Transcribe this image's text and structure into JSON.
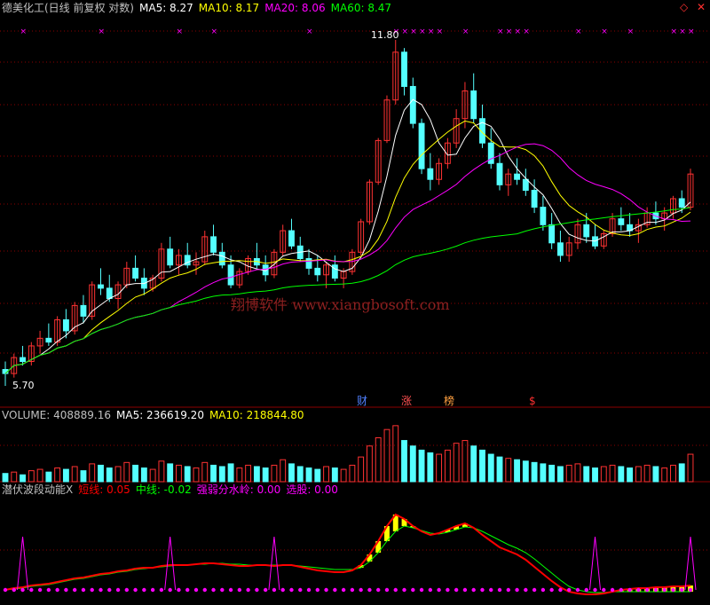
{
  "colors": {
    "bg": "#000000",
    "up": "#ff3232",
    "down": "#54ffff",
    "grid": "#8b0000",
    "ma5": "#ffffff",
    "ma10": "#ffff00",
    "ma20": "#ff00ff",
    "ma60": "#00ff00",
    "short": "#ff0000",
    "mid": "#00ff00",
    "strong": "#ffff00",
    "watershed": "#ff00ff",
    "pick": "#ff00ff"
  },
  "main": {
    "title": "德美化工(日线 前复权 对数)",
    "ma5": "MA5: 8.27",
    "ma10": "MA10: 8.17",
    "ma20": "MA20: 8.06",
    "ma60": "MA60: 8.47",
    "high_label": "11.80",
    "low_label": "5.70",
    "watermark": "翔博软件 www.xiangbosoft.com",
    "markers": [
      "财",
      "涨",
      "榜",
      "$"
    ]
  },
  "volume": {
    "label": "VOLUME: 408889.16",
    "ma5": "MA5: 236619.20",
    "ma10": "MA10: 218844.80"
  },
  "indicator": {
    "name": "潜伏波段动能X",
    "short": "短线: 0.05",
    "mid": "中线: -0.02",
    "watershed": "强弱分水岭: 0.00",
    "pick": "选股: 0.00"
  },
  "window_icons": [
    "diamond-icon",
    "close-icon"
  ],
  "chart_data": {
    "type": "candlestick",
    "title": "德美化工(日线 前复权 对数)",
    "price_range": [
      5.7,
      11.8
    ],
    "candles": [
      [
        5.9,
        6.0,
        5.7,
        5.85
      ],
      [
        5.85,
        6.1,
        5.8,
        6.05
      ],
      [
        6.05,
        6.2,
        5.95,
        6.0
      ],
      [
        6.0,
        6.25,
        5.95,
        6.2
      ],
      [
        6.2,
        6.4,
        6.1,
        6.3
      ],
      [
        6.3,
        6.5,
        6.2,
        6.25
      ],
      [
        6.25,
        6.6,
        6.2,
        6.55
      ],
      [
        6.55,
        6.7,
        6.3,
        6.4
      ],
      [
        6.4,
        6.8,
        6.35,
        6.75
      ],
      [
        6.75,
        6.9,
        6.5,
        6.6
      ],
      [
        6.6,
        7.1,
        6.55,
        7.05
      ],
      [
        7.05,
        7.3,
        6.9,
        7.0
      ],
      [
        7.0,
        7.2,
        6.8,
        6.85
      ],
      [
        6.85,
        7.1,
        6.7,
        7.05
      ],
      [
        7.05,
        7.4,
        7.0,
        7.3
      ],
      [
        7.3,
        7.5,
        7.1,
        7.15
      ],
      [
        7.15,
        7.3,
        6.9,
        7.0
      ],
      [
        7.0,
        7.2,
        6.95,
        7.15
      ],
      [
        7.15,
        7.7,
        7.1,
        7.6
      ],
      [
        7.6,
        7.8,
        7.3,
        7.35
      ],
      [
        7.35,
        7.6,
        7.2,
        7.5
      ],
      [
        7.5,
        7.7,
        7.3,
        7.35
      ],
      [
        7.35,
        7.55,
        7.2,
        7.4
      ],
      [
        7.4,
        7.9,
        7.35,
        7.8
      ],
      [
        7.8,
        8.0,
        7.5,
        7.55
      ],
      [
        7.55,
        7.7,
        7.3,
        7.35
      ],
      [
        7.35,
        7.5,
        7.0,
        7.05
      ],
      [
        7.05,
        7.3,
        7.0,
        7.25
      ],
      [
        7.25,
        7.5,
        7.2,
        7.45
      ],
      [
        7.45,
        7.7,
        7.3,
        7.35
      ],
      [
        7.35,
        7.5,
        7.1,
        7.2
      ],
      [
        7.2,
        7.6,
        7.15,
        7.55
      ],
      [
        7.55,
        8.0,
        7.5,
        7.9
      ],
      [
        7.9,
        8.1,
        7.6,
        7.65
      ],
      [
        7.65,
        7.8,
        7.4,
        7.45
      ],
      [
        7.45,
        7.6,
        7.2,
        7.3
      ],
      [
        7.3,
        7.5,
        7.1,
        7.2
      ],
      [
        7.2,
        7.4,
        7.0,
        7.35
      ],
      [
        7.35,
        7.5,
        7.1,
        7.15
      ],
      [
        7.15,
        7.3,
        7.0,
        7.25
      ],
      [
        7.25,
        7.6,
        7.2,
        7.55
      ],
      [
        7.55,
        8.1,
        7.5,
        8.05
      ],
      [
        8.05,
        8.8,
        8.0,
        8.75
      ],
      [
        8.75,
        9.6,
        8.7,
        9.55
      ],
      [
        9.55,
        10.5,
        9.5,
        10.4
      ],
      [
        10.4,
        11.8,
        10.3,
        11.5
      ],
      [
        11.5,
        11.6,
        10.5,
        10.7
      ],
      [
        10.7,
        10.9,
        9.8,
        9.9
      ],
      [
        9.9,
        10.0,
        8.9,
        9.0
      ],
      [
        9.0,
        9.3,
        8.6,
        8.8
      ],
      [
        8.8,
        9.2,
        8.7,
        9.1
      ],
      [
        9.1,
        9.6,
        9.0,
        9.5
      ],
      [
        9.5,
        10.2,
        9.4,
        10.0
      ],
      [
        10.0,
        10.8,
        9.8,
        10.6
      ],
      [
        10.6,
        11.0,
        9.9,
        10.0
      ],
      [
        10.0,
        10.3,
        9.4,
        9.5
      ],
      [
        9.5,
        9.8,
        9.0,
        9.1
      ],
      [
        9.1,
        9.3,
        8.6,
        8.7
      ],
      [
        8.7,
        9.0,
        8.5,
        8.9
      ],
      [
        8.9,
        9.2,
        8.7,
        8.8
      ],
      [
        8.8,
        9.0,
        8.5,
        8.6
      ],
      [
        8.6,
        8.8,
        8.2,
        8.3
      ],
      [
        8.3,
        8.5,
        7.9,
        8.0
      ],
      [
        8.0,
        8.2,
        7.6,
        7.7
      ],
      [
        7.7,
        7.9,
        7.4,
        7.5
      ],
      [
        7.5,
        7.8,
        7.4,
        7.7
      ],
      [
        7.7,
        8.1,
        7.6,
        8.0
      ],
      [
        8.0,
        8.2,
        7.7,
        7.8
      ],
      [
        7.8,
        8.0,
        7.6,
        7.65
      ],
      [
        7.65,
        7.9,
        7.6,
        7.85
      ],
      [
        7.85,
        8.2,
        7.8,
        8.1
      ],
      [
        8.1,
        8.3,
        7.9,
        8.0
      ],
      [
        8.0,
        8.2,
        7.8,
        7.9
      ],
      [
        7.9,
        8.1,
        7.7,
        8.0
      ],
      [
        8.0,
        8.3,
        7.95,
        8.2
      ],
      [
        8.2,
        8.4,
        8.0,
        8.1
      ],
      [
        8.1,
        8.3,
        7.9,
        8.2
      ],
      [
        8.2,
        8.5,
        8.1,
        8.45
      ],
      [
        8.45,
        8.6,
        8.2,
        8.3
      ],
      [
        8.3,
        9.0,
        8.25,
        8.9
      ]
    ],
    "volume_range": [
      0,
      420000
    ],
    "volume": [
      60000,
      70000,
      50000,
      80000,
      90000,
      70000,
      100000,
      90000,
      110000,
      80000,
      130000,
      120000,
      100000,
      110000,
      140000,
      120000,
      100000,
      90000,
      150000,
      130000,
      120000,
      110000,
      100000,
      140000,
      120000,
      110000,
      130000,
      100000,
      120000,
      110000,
      100000,
      120000,
      160000,
      130000,
      110000,
      100000,
      90000,
      110000,
      100000,
      90000,
      120000,
      180000,
      260000,
      320000,
      380000,
      408000,
      300000,
      260000,
      230000,
      210000,
      200000,
      230000,
      280000,
      300000,
      260000,
      230000,
      200000,
      180000,
      170000,
      160000,
      150000,
      140000,
      130000,
      120000,
      110000,
      120000,
      130000,
      110000,
      100000,
      110000,
      120000,
      110000,
      100000,
      110000,
      120000,
      110000,
      100000,
      120000,
      130000,
      200000
    ],
    "indicator_range": [
      -0.1,
      1.0
    ],
    "short_line": [
      0.0,
      0.02,
      0.03,
      0.05,
      0.06,
      0.07,
      0.09,
      0.11,
      0.13,
      0.14,
      0.16,
      0.18,
      0.19,
      0.21,
      0.22,
      0.24,
      0.25,
      0.25,
      0.27,
      0.28,
      0.28,
      0.28,
      0.29,
      0.3,
      0.3,
      0.29,
      0.28,
      0.27,
      0.27,
      0.28,
      0.28,
      0.27,
      0.28,
      0.28,
      0.26,
      0.24,
      0.22,
      0.21,
      0.2,
      0.2,
      0.22,
      0.28,
      0.4,
      0.55,
      0.72,
      0.85,
      0.8,
      0.72,
      0.66,
      0.62,
      0.64,
      0.68,
      0.72,
      0.75,
      0.7,
      0.62,
      0.55,
      0.48,
      0.44,
      0.4,
      0.34,
      0.26,
      0.18,
      0.1,
      0.03,
      -0.02,
      -0.04,
      -0.05,
      -0.05,
      -0.04,
      -0.02,
      0.0,
      0.01,
      0.02,
      0.02,
      0.03,
      0.03,
      0.04,
      0.04,
      0.05
    ],
    "mid_line": [
      0.0,
      0.01,
      0.02,
      0.04,
      0.05,
      0.06,
      0.08,
      0.1,
      0.12,
      0.13,
      0.15,
      0.17,
      0.18,
      0.2,
      0.21,
      0.23,
      0.24,
      0.25,
      0.26,
      0.27,
      0.28,
      0.28,
      0.29,
      0.29,
      0.3,
      0.3,
      0.29,
      0.29,
      0.28,
      0.28,
      0.28,
      0.28,
      0.28,
      0.28,
      0.27,
      0.26,
      0.25,
      0.24,
      0.23,
      0.23,
      0.23,
      0.25,
      0.32,
      0.42,
      0.55,
      0.66,
      0.72,
      0.7,
      0.67,
      0.64,
      0.63,
      0.65,
      0.68,
      0.71,
      0.7,
      0.66,
      0.61,
      0.56,
      0.51,
      0.47,
      0.42,
      0.35,
      0.27,
      0.19,
      0.11,
      0.04,
      0.0,
      -0.02,
      -0.03,
      -0.03,
      -0.02,
      -0.02,
      -0.02,
      -0.02,
      -0.02,
      -0.02,
      -0.02,
      -0.02,
      -0.02,
      -0.02
    ],
    "spikes_at": [
      2,
      19,
      31,
      68,
      79
    ]
  }
}
